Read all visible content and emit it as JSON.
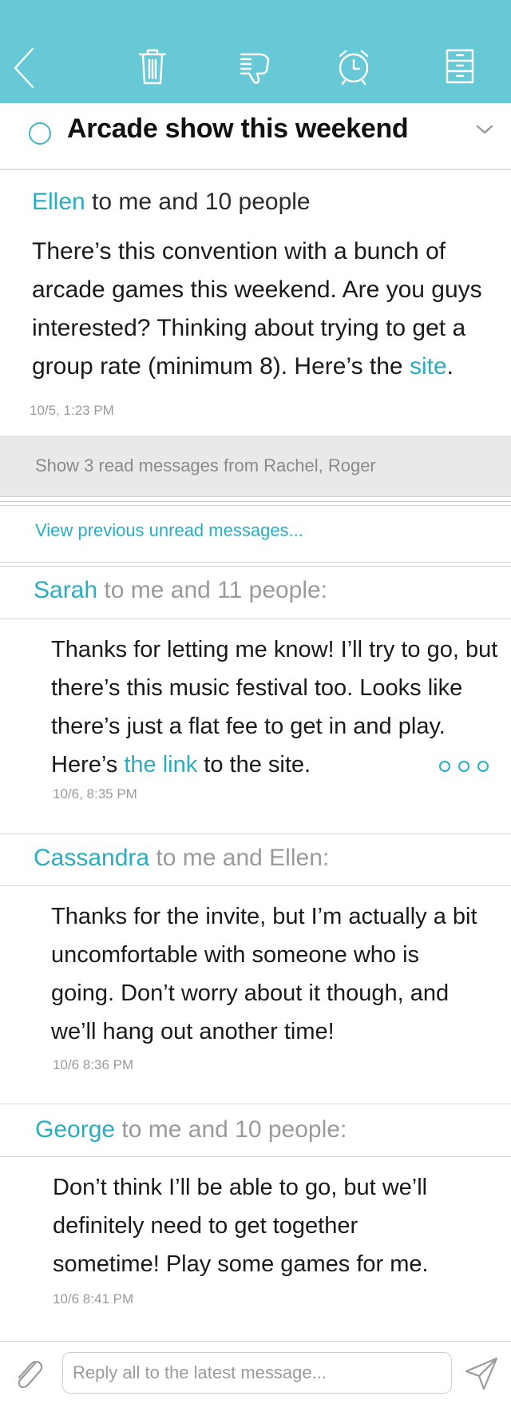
{
  "toolbar": {
    "icons": [
      "back-icon",
      "trash-icon",
      "thumbs-down-icon",
      "alarm-clock-icon",
      "archive-cabinet-icon"
    ],
    "color": "#67c9d6"
  },
  "subject": {
    "title": "Arcade show this weekend"
  },
  "first_message": {
    "sender": "Ellen",
    "recipients": " to me and 10 people",
    "body_before_link": "There’s this convention with a bunch of arcade games this weekend. Are you guys interested? Thinking about trying to get a group rate (minimum 8). Here’s the ",
    "link_text": "site",
    "body_after_link": ".",
    "timestamp": "10/5, 1:23 PM"
  },
  "read_messages": {
    "label": "Show 3 read messages from Rachel, Roger"
  },
  "previous_unread": {
    "label": "View previous unread messages..."
  },
  "messages": [
    {
      "sender": "Sarah",
      "recipients": " to me and 11 people:",
      "body_before_link": "Thanks for letting me know! I’ll try to go, but there’s this music festival too. Looks like there’s just a flat fee to get in and play. Here’s ",
      "link_text": "the link",
      "body_after_link": " to the site.",
      "timestamp": "10/6, 8:35 PM"
    },
    {
      "sender": "Cassandra",
      "recipients": " to me and Ellen:",
      "body": "Thanks for the invite, but I’m actually a bit uncomfortable with someone who is going. Don’t worry about it though, and we’ll hang out another time!",
      "timestamp": "10/6 8:36 PM"
    },
    {
      "sender": "George",
      "recipients": " to me and 10 people:",
      "body": "Don’t think I’ll be able to go, but we’ll definitely need to get together sometime! Play some games for me.",
      "timestamp": "10/6 8:41 PM"
    }
  ],
  "reply": {
    "placeholder": "Reply all to the latest message..."
  },
  "colors": {
    "accent": "#2aaebf",
    "toolbar": "#67c9d6",
    "band": "#e9e9e9"
  }
}
